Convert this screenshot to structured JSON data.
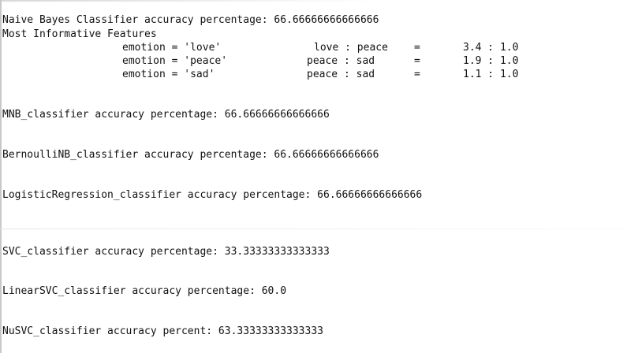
{
  "nb": {
    "accuracy_line": "Naive Bayes Classifier accuracy percentage: 66.66666666666666",
    "features_header": "Most Informative Features",
    "features": [
      {
        "feature": "emotion = 'love'",
        "pair": "love : peace",
        "eq": "=",
        "ratio": "3.4 : 1.0"
      },
      {
        "feature": "emotion = 'peace'",
        "pair": "peace : sad",
        "eq": "=",
        "ratio": "1.9 : 1.0"
      },
      {
        "feature": "emotion = 'sad'",
        "pair": "peace : sad",
        "eq": "=",
        "ratio": "1.1 : 1.0"
      }
    ]
  },
  "results": {
    "mnb": "MNB_classifier accuracy percentage: 66.66666666666666",
    "bernoulli": "BernoulliNB_classifier accuracy percentage: 66.66666666666666",
    "logreg": "LogisticRegression_classifier accuracy percentage: 66.66666666666666",
    "svc": "SVC_classifier accuracy percentage: 33.33333333333333",
    "linsvc": "LinearSVC_classifier accuracy percentage: 60.0",
    "nusvc": "NuSVC_classifier accuracy percent: 63.33333333333333"
  }
}
